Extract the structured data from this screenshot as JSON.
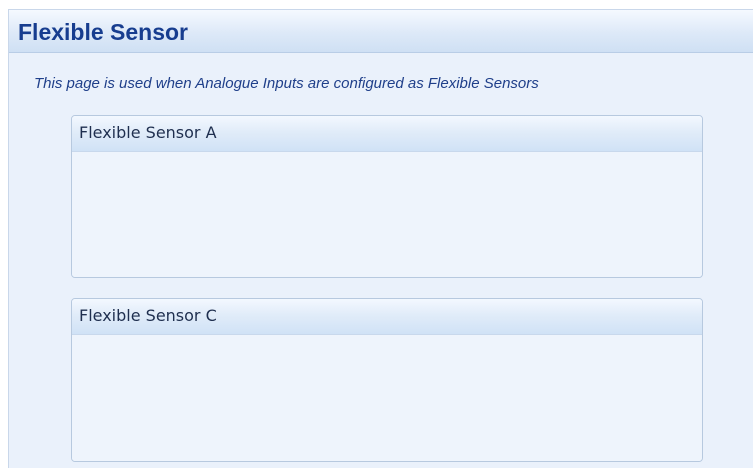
{
  "page": {
    "title": "Flexible Sensor",
    "description": "This page is used when Analogue Inputs are configured as Flexible Sensors"
  },
  "groups": [
    {
      "title": "Flexible Sensor A"
    },
    {
      "title": "Flexible Sensor C"
    }
  ],
  "colors": {
    "title": "#173d8f",
    "description": "#1f3f8a",
    "panel_background": "#eaf1fb",
    "group_border": "#b7c9df"
  }
}
